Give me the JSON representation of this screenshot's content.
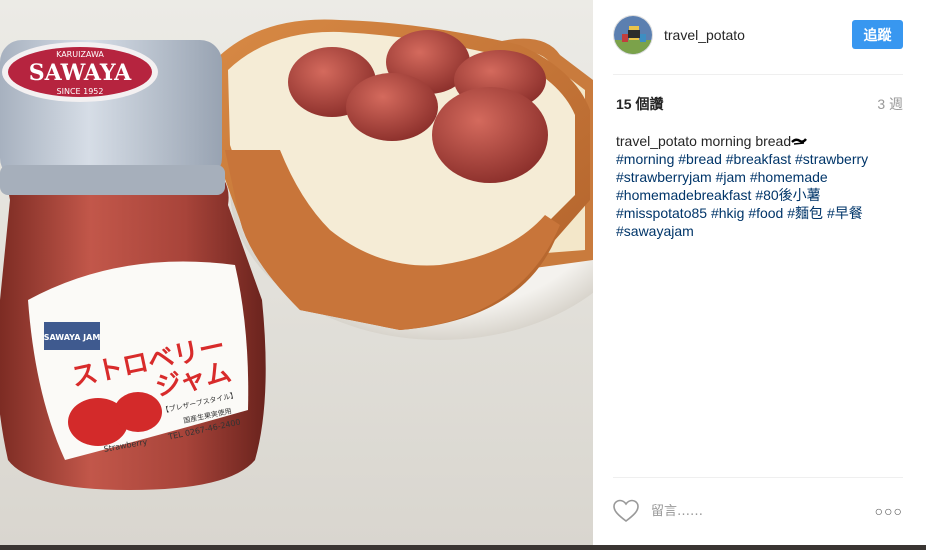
{
  "post": {
    "username": "travel_potato",
    "follow_label": "追蹤",
    "likes": "15 個讚",
    "time_ago": "3 週",
    "caption_text": "morning bread",
    "hashtags": [
      "#morning",
      "#bread",
      "#breakfast",
      "#strawberry",
      "#strawberryjam",
      "#jam",
      "#homemade",
      "#homemadebreakfast",
      "#80後小薯",
      "#misspotato85",
      "#hkig",
      "#food",
      "#麵包",
      "#早餐",
      "#sawayajam"
    ],
    "comment_placeholder": "留言……",
    "more_label": "○○○"
  },
  "photo": {
    "jar_lid_brand": "SAWAYA",
    "jar_lid_top": "KARUIZAWA",
    "jar_lid_since": "SINCE 1952",
    "label_brand": "SAWAYA JAM",
    "label_title_1": "ストロベリー",
    "label_title_2": "ジャム",
    "label_sub": "【プレザーブスタイル】",
    "label_origin": "国産生果実使用",
    "label_tel": "TEL 0267-46-2400",
    "label_fruit": "Strawberry"
  },
  "colors": {
    "accent": "#3897f0",
    "link": "#003569",
    "muted": "#999999"
  }
}
